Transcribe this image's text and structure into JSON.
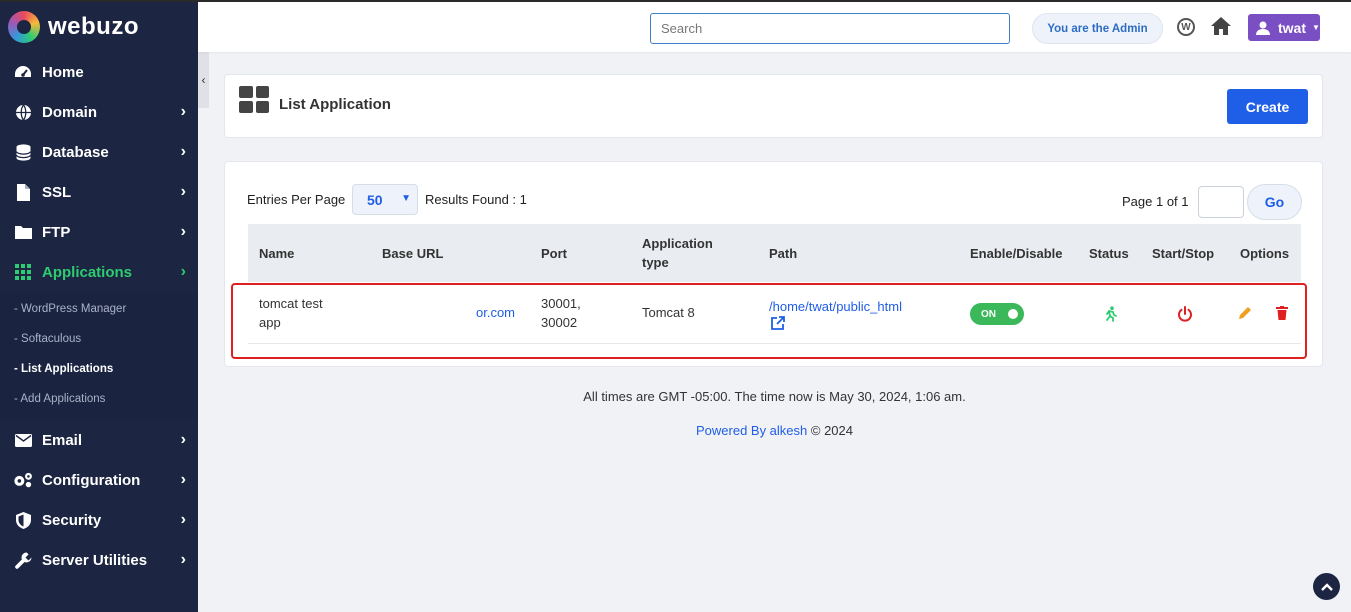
{
  "brand": {
    "name": "webuzo"
  },
  "sidebar": {
    "items": [
      {
        "label": "Home",
        "icon": "dashboard-icon",
        "has_chevron": false
      },
      {
        "label": "Domain",
        "icon": "globe-icon",
        "has_chevron": true
      },
      {
        "label": "Database",
        "icon": "database-icon",
        "has_chevron": true
      },
      {
        "label": "SSL",
        "icon": "file-icon",
        "has_chevron": true
      },
      {
        "label": "FTP",
        "icon": "folder-icon",
        "has_chevron": true
      },
      {
        "label": "Applications",
        "icon": "grid-icon",
        "has_chevron": true,
        "active": true
      },
      {
        "label": "Email",
        "icon": "envelope-icon",
        "has_chevron": true
      },
      {
        "label": "Configuration",
        "icon": "gears-icon",
        "has_chevron": true
      },
      {
        "label": "Security",
        "icon": "shield-icon",
        "has_chevron": true
      },
      {
        "label": "Server Utilities",
        "icon": "wrench-icon",
        "has_chevron": true
      }
    ],
    "sub_items": [
      {
        "label": "- WordPress Manager"
      },
      {
        "label": "- Softaculous"
      },
      {
        "label": "- List Applications",
        "current": true
      },
      {
        "label": "- Add Applications"
      }
    ],
    "active_color": "#2ecc71"
  },
  "topbar": {
    "search_placeholder": "Search",
    "admin_label": "You are the Admin",
    "user_label": "twat"
  },
  "header": {
    "title": "List Application",
    "create_label": "Create"
  },
  "table_controls": {
    "entries_label": "Entries Per Page",
    "entries_value": "50",
    "results_label": "Results Found : 1",
    "page_label": "Page 1 of 1",
    "go_label": "Go"
  },
  "table": {
    "columns": [
      "Name",
      "Base URL",
      "Port",
      "Application type",
      "Path",
      "Enable/Disable",
      "Status",
      "Start/Stop",
      "Options"
    ],
    "column_app_type_line1": "Application",
    "column_app_type_line2": "type",
    "rows": [
      {
        "name_line1": "tomcat test",
        "name_line2": "app",
        "base_url": "or.com",
        "port_line1": "30001,",
        "port_line2": "30002",
        "app_type": "Tomcat 8",
        "path": "/home/twat/public_html",
        "toggle": "ON"
      }
    ]
  },
  "footer": {
    "time_text": "All times are GMT -05:00. The time now is May 30, 2024, 1:06 am.",
    "powered_prefix": "Powered By alkesh",
    "powered_suffix": "© 2024"
  },
  "colors": {
    "sidebar_bg": "#1c2541",
    "primary": "#1f5ee6",
    "toggle_on": "#3bb85a",
    "status_running": "#2ecc71",
    "stop_red": "#e02020",
    "edit_orange": "#f0a020",
    "user_purple": "#7b4fc4"
  }
}
